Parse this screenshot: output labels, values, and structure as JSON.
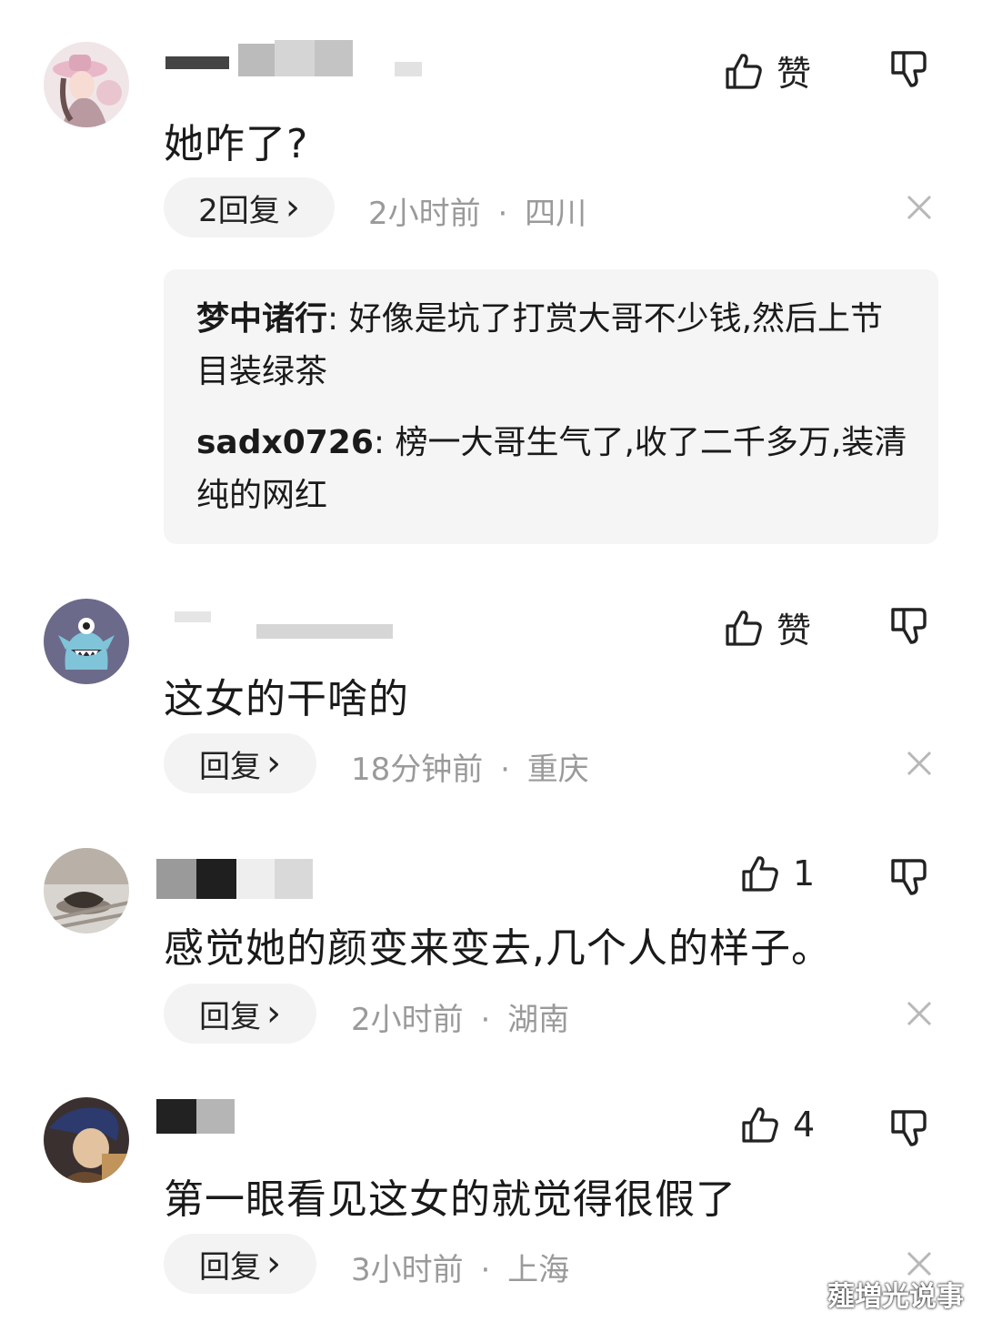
{
  "comments": [
    {
      "text": "她咋了?",
      "likes": "赞",
      "reply_label": "2回复",
      "time": "2小时前",
      "location": "四川",
      "replies": [
        {
          "user": "梦中诸行",
          "text": "好像是坑了打赏大哥不少钱,然后上节目装绿茶"
        },
        {
          "user": "sadx0726",
          "text": "榜一大哥生气了,收了二千多万,装清纯的网红"
        }
      ]
    },
    {
      "text": "这女的干啥的",
      "likes": "赞",
      "reply_label": "回复",
      "time": "18分钟前",
      "location": "重庆"
    },
    {
      "text": "感觉她的颜变来变去,几个人的样子。",
      "likes": "1",
      "reply_label": "回复",
      "time": "2小时前",
      "location": "湖南"
    },
    {
      "text": "第一眼看见这女的就觉得很假了",
      "likes": "4",
      "reply_label": "回复",
      "time": "3小时前",
      "location": "上海"
    }
  ],
  "separator": "·",
  "chevron": "›",
  "watermark": "薤増光说事",
  "icons": [
    "thumbs-up-icon",
    "thumbs-down-icon",
    "close-icon",
    "chevron-right-icon"
  ],
  "colors": {
    "meta_text": "#9a9a9a",
    "pill_bg": "#f3f3f3",
    "reply_box_bg": "#f5f5f5"
  }
}
